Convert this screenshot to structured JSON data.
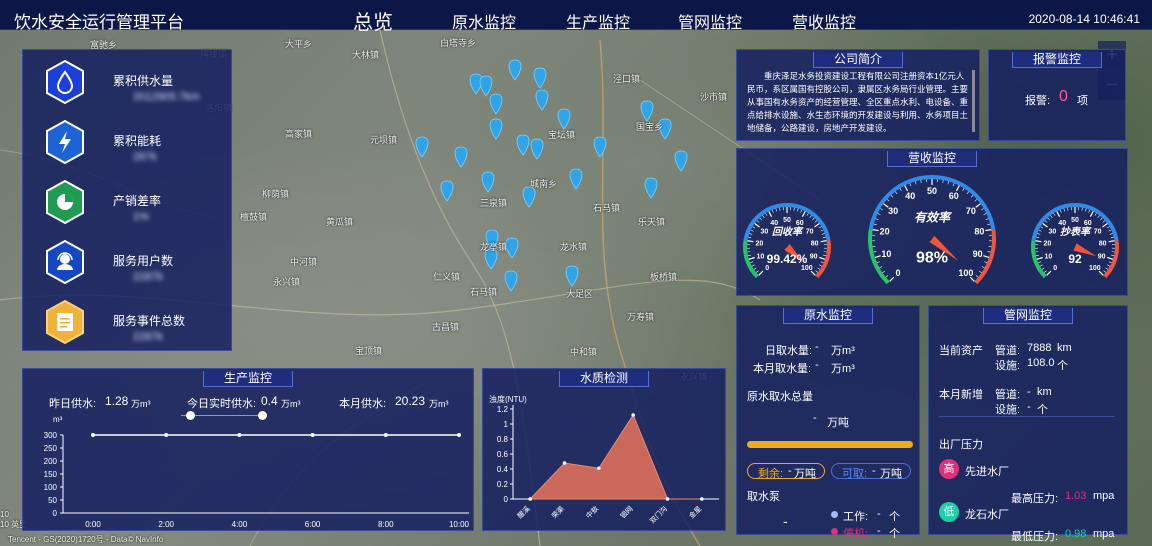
{
  "header": {
    "title": "饮水安全运行管理平台",
    "nav": [
      "总览",
      "原水监控",
      "生产监控",
      "管网监控",
      "营收监控"
    ],
    "active": "总览",
    "datetime": "2020-08-14  10:46:41"
  },
  "map": {
    "places": [
      {
        "t": "富驰乡",
        "x": 90,
        "y": 38
      },
      {
        "t": "大平乡",
        "x": 285,
        "y": 37
      },
      {
        "t": "白塔寺乡",
        "x": 440,
        "y": 36
      },
      {
        "t": "牌楼镇",
        "x": 200,
        "y": 47
      },
      {
        "t": "大林镇",
        "x": 352,
        "y": 48
      },
      {
        "t": "泾口镇",
        "x": 613,
        "y": 72
      },
      {
        "t": "沙市镇",
        "x": 700,
        "y": 90
      },
      {
        "t": "洛阳镇",
        "x": 205,
        "y": 101
      },
      {
        "t": "高家镇",
        "x": 285,
        "y": 127
      },
      {
        "t": "元坝镇",
        "x": 370,
        "y": 133
      },
      {
        "t": "宝坛镇",
        "x": 548,
        "y": 128
      },
      {
        "t": "国宝乡",
        "x": 636,
        "y": 120
      },
      {
        "t": "柳荫镇",
        "x": 262,
        "y": 187
      },
      {
        "t": "城南乡",
        "x": 530,
        "y": 177
      },
      {
        "t": "三泉镇",
        "x": 480,
        "y": 196
      },
      {
        "t": "石马镇",
        "x": 593,
        "y": 201
      },
      {
        "t": "檀鼓镇",
        "x": 240,
        "y": 210
      },
      {
        "t": "黄瓜镇",
        "x": 326,
        "y": 215
      },
      {
        "t": "乐天镇",
        "x": 638,
        "y": 215
      },
      {
        "t": "龙亭镇",
        "x": 480,
        "y": 240
      },
      {
        "t": "龙水镇",
        "x": 560,
        "y": 240
      },
      {
        "t": "中河镇",
        "x": 290,
        "y": 255
      },
      {
        "t": "永兴镇",
        "x": 273,
        "y": 275
      },
      {
        "t": "仁义镇",
        "x": 433,
        "y": 270
      },
      {
        "t": "板桥镇",
        "x": 650,
        "y": 270
      },
      {
        "t": "石马镇",
        "x": 470,
        "y": 285
      },
      {
        "t": "大足区",
        "x": 566,
        "y": 287
      },
      {
        "t": "万寿镇",
        "x": 627,
        "y": 310
      },
      {
        "t": "古昌镇",
        "x": 432,
        "y": 320
      },
      {
        "t": "宝顶镇",
        "x": 355,
        "y": 344
      },
      {
        "t": "中和镇",
        "x": 570,
        "y": 345
      },
      {
        "t": "永兴镇",
        "x": 680,
        "y": 370
      }
    ],
    "pin_color": "#2fa4e7",
    "copyright": "Tencent - GS(2020)1720号 - Data© NavInfo"
  },
  "stats": {
    "items": [
      {
        "label": "累积供水量",
        "value": "2012905.7km",
        "icon": "water-drop-icon",
        "color": "#1c3fd8"
      },
      {
        "label": "累积能耗",
        "value": "267k",
        "icon": "lightning-icon",
        "color": "#1d63d4"
      },
      {
        "label": "产销差率",
        "value": "1%",
        "icon": "pie-chart-icon",
        "color": "#1f9c52"
      },
      {
        "label": "服务用户数",
        "value": "2287k",
        "icon": "user-service-icon",
        "color": "#1547c2"
      },
      {
        "label": "服务事件总数",
        "value": "2287k",
        "icon": "event-form-icon",
        "color": "#f0b23a"
      }
    ]
  },
  "company": {
    "title": "公司简介",
    "text": "重庆泽足水务投资建设工程有限公司注册资本1亿元人民币，系区属国有控股公司，隶属区水务局行业管理。主要从事国有水务资产的经营管理、全区重点水利、电设备、重点给排水设施、水生态环境的开发建设与利用、水务项目土地储备，公路建设，房地产开发建设。"
  },
  "alarm": {
    "title": "报警监控",
    "label": "报警:",
    "count": "0",
    "unit": "项"
  },
  "revenue": {
    "title": "营收监控",
    "gauges": [
      {
        "name": "回收率",
        "value": "99.42%"
      },
      {
        "name": "有效率",
        "value": "98%"
      },
      {
        "name": "抄表率",
        "value": "92"
      }
    ],
    "ticks_small": [
      "0",
      "10",
      "20",
      "30",
      "40",
      "50",
      "60",
      "70",
      "80",
      "90",
      "100"
    ]
  },
  "raw": {
    "title": "原水监控",
    "daily_label": "日取水量:",
    "daily_value": "-",
    "daily_unit": "万m³",
    "month_label": "本月取水量:",
    "month_value": "-",
    "month_unit": "万m³",
    "total_label": "原水取水总量",
    "total_value": "-",
    "total_unit": "万吨",
    "remain_label": "剩余:",
    "remain_value": "-",
    "remain_unit": "万吨",
    "avail_label": "可取:",
    "avail_value": "-",
    "avail_unit": "万吨",
    "pump_label": "取水泵",
    "pump_value": "-",
    "work_label": "工作:",
    "work_value": "-",
    "work_unit": "个",
    "stop_label": "停机:",
    "stop_value": "-",
    "stop_unit": "个"
  },
  "pipe": {
    "title": "管网监控",
    "assets_label": "当前资产",
    "pipe_label": "管道:",
    "pipe_value": "7888",
    "pipe_unit": "km",
    "facility_label": "设施:",
    "facility_value": "108.0",
    "facility_unit": "个",
    "new_label": "本月新增",
    "new_pipe_label": "管道:",
    "new_pipe_value": "-",
    "new_pipe_unit": "km",
    "new_fac_label": "设施:",
    "new_fac_value": "-",
    "new_fac_unit": "个",
    "pressure_label": "出厂压力",
    "plants": [
      {
        "badge": "高",
        "name": "先进水厂",
        "badge_color": "#e0307a"
      },
      {
        "badge": "低",
        "name": "龙石水厂",
        "badge_color": "#1ed0a8"
      }
    ],
    "max_label": "最高压力:",
    "max_value": "1.03",
    "max_unit": "mpa",
    "min_label": "最低压力:",
    "min_value": "0.98",
    "min_unit": "mpa"
  },
  "production": {
    "title": "生产监控",
    "yesterday_label": "昨日供水:",
    "yesterday_value": "1.28",
    "yesterday_unit": "万m³",
    "realtime_label": "今日实时供水:",
    "realtime_value": "0.4",
    "realtime_unit": "万m³",
    "month_label": "本月供水:",
    "month_value": "20.23",
    "month_unit": "万m³"
  },
  "water_quality": {
    "title": "水质检测"
  },
  "chart_data": [
    {
      "type": "line",
      "ylabel": "m³",
      "x": [
        "0:00",
        "2:00",
        "4:00",
        "6:00",
        "8:00",
        "10:00"
      ],
      "values": [
        300,
        300,
        300,
        300,
        300,
        300
      ],
      "ylim": [
        0,
        300
      ],
      "yticks": [
        0,
        50,
        100,
        150,
        200,
        250,
        300
      ],
      "grid": false
    },
    {
      "type": "area",
      "ylabel": "浊度(NTU)",
      "categories": [
        "醒溪",
        "荣渠",
        "中敖",
        "银网",
        "双门沟",
        "金星"
      ],
      "values": [
        0,
        0.48,
        0.41,
        1.12,
        0,
        0
      ],
      "ylim": [
        0,
        1.2
      ],
      "yticks": [
        0,
        0.2,
        0.4,
        0.6,
        0.8,
        1,
        1.2
      ],
      "grid": false
    }
  ]
}
